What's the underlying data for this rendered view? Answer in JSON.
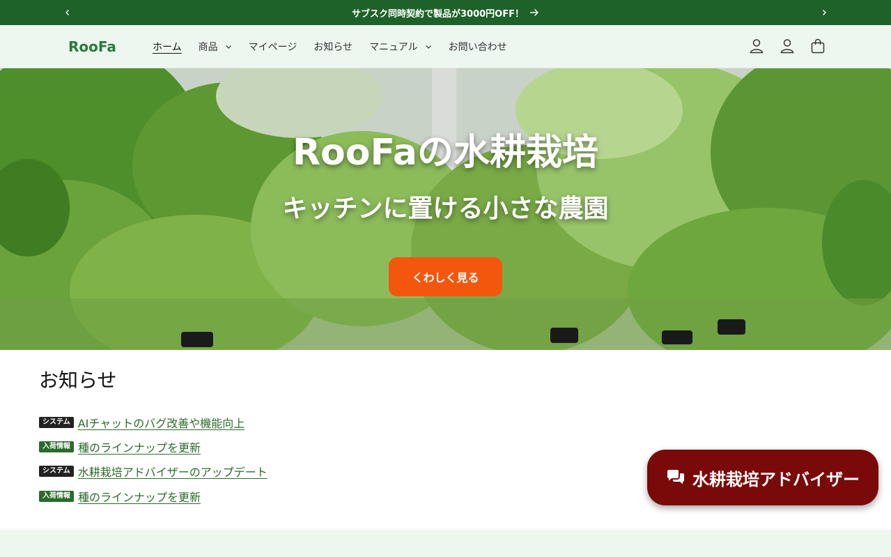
{
  "announcement": {
    "text": "サブスク同時契約で製品が3000円OFF！",
    "prev_icon": "chevron-left-icon",
    "next_icon": "chevron-right-icon",
    "arrow_icon": "arrow-right-icon"
  },
  "header": {
    "logo": "RooFa",
    "nav": [
      {
        "label": "ホーム",
        "active": true,
        "dropdown": false
      },
      {
        "label": "商品",
        "active": false,
        "dropdown": true
      },
      {
        "label": "マイページ",
        "active": false,
        "dropdown": false
      },
      {
        "label": "お知らせ",
        "active": false,
        "dropdown": false
      },
      {
        "label": "マニュアル",
        "active": false,
        "dropdown": true
      },
      {
        "label": "お問い合わせ",
        "active": false,
        "dropdown": false
      }
    ],
    "icons": [
      "user-icon",
      "user-icon",
      "cart-icon"
    ]
  },
  "hero": {
    "title": "RooFaの水耕栽培",
    "subtitle": "キッチンに置ける小さな農園",
    "button_label": "くわしく見る"
  },
  "news": {
    "heading": "お知らせ",
    "items": [
      {
        "tag": "システム",
        "tag_type": "sys",
        "title": "AIチャットのバグ改善や機能向上"
      },
      {
        "tag": "入荷情報",
        "tag_type": "stock",
        "title": "種のラインナップを更新"
      },
      {
        "tag": "システム",
        "tag_type": "sys",
        "title": "水耕栽培アドバイザーのアップデート"
      },
      {
        "tag": "入荷情報",
        "tag_type": "stock",
        "title": "種のラインナップを更新"
      }
    ]
  },
  "advisor": {
    "label": "水耕栽培アドバイザー",
    "icon": "chat-bubbles-icon"
  },
  "colors": {
    "announce_bg": "#1f6229",
    "header_bg": "#eef6f0",
    "cta_orange": "#f3570d",
    "advisor_bg": "#7a0a0a",
    "link_green": "#2b6a2b"
  }
}
